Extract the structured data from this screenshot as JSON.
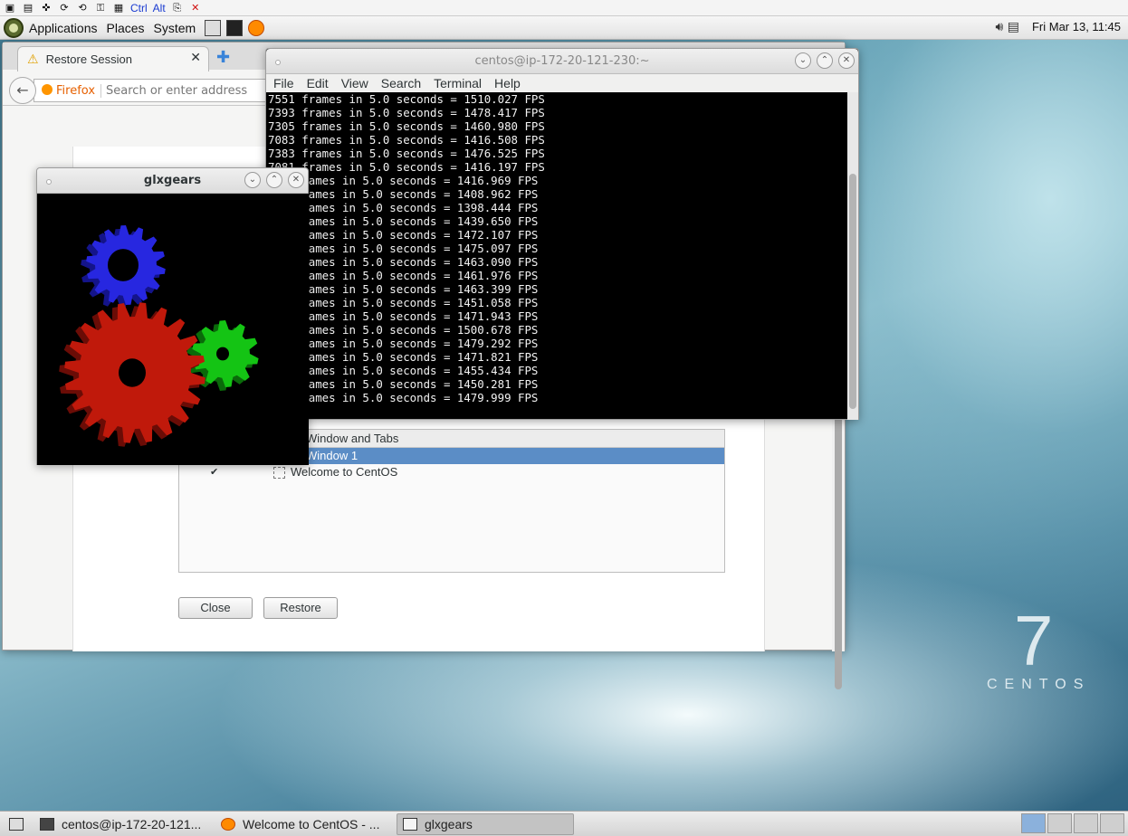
{
  "toolbar0": {
    "ctrl_label": "Ctrl",
    "alt_label": "Alt"
  },
  "topbar": {
    "menus": [
      "Applications",
      "Places",
      "System"
    ],
    "clock": "Fri Mar 13, 11:45"
  },
  "firefox": {
    "tab_title": "Restore Session",
    "url_brand": "Firefox",
    "url_placeholder": "Search or enter address",
    "tree_header": "Window and Tabs",
    "tree_selected": "Window 1",
    "tree_row_label": "Welcome to CentOS",
    "close_label": "Close",
    "restore_label": "Restore"
  },
  "terminal": {
    "title": "centos@ip-172-20-121-230:~",
    "menu": [
      "File",
      "Edit",
      "View",
      "Search",
      "Terminal",
      "Help"
    ],
    "lines": [
      "7551 frames in 5.0 seconds = 1510.027 FPS",
      "7393 frames in 5.0 seconds = 1478.417 FPS",
      "7305 frames in 5.0 seconds = 1460.980 FPS",
      "7083 frames in 5.0 seconds = 1416.508 FPS",
      "7383 frames in 5.0 seconds = 1476.525 FPS",
      "7081 frames in 5.0 seconds = 1416.197 FPS",
      "     rames in 5.0 seconds = 1416.969 FPS",
      "     rames in 5.0 seconds = 1408.962 FPS",
      "     rames in 5.0 seconds = 1398.444 FPS",
      "     rames in 5.0 seconds = 1439.650 FPS",
      "     rames in 5.0 seconds = 1472.107 FPS",
      "     rames in 5.0 seconds = 1475.097 FPS",
      "     rames in 5.0 seconds = 1463.090 FPS",
      "     rames in 5.0 seconds = 1461.976 FPS",
      "     rames in 5.0 seconds = 1463.399 FPS",
      "     rames in 5.0 seconds = 1451.058 FPS",
      "     rames in 5.0 seconds = 1471.943 FPS",
      "     rames in 5.0 seconds = 1500.678 FPS",
      "     rames in 5.0 seconds = 1479.292 FPS",
      "     rames in 5.0 seconds = 1471.821 FPS",
      "     rames in 5.0 seconds = 1455.434 FPS",
      "     rames in 5.0 seconds = 1450.281 FPS",
      "     rames in 5.0 seconds = 1479.999 FPS"
    ]
  },
  "glxgears": {
    "title": "glxgears"
  },
  "taskbar": {
    "tasks": [
      "centos@ip-172-20-121...",
      "Welcome to CentOS - ...",
      "glxgears"
    ]
  },
  "desktop": {
    "logo_number": "7",
    "logo_word": "CENTOS"
  },
  "colors": {
    "gear_red": "#c0190b",
    "gear_green": "#14c414",
    "gear_blue": "#2727e0",
    "selection": "#5b8dc6"
  }
}
